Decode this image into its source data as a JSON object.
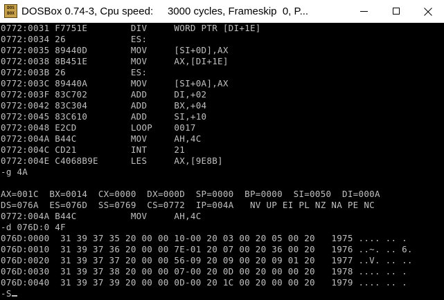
{
  "window": {
    "title": "DOSBox 0.74-3, Cpu speed:     3000 cycles, Frameskip  0, P...",
    "icon": "dosbox-icon",
    "icon_text_top": "DOS",
    "icon_text_bottom": "BOX"
  },
  "console": {
    "lines": [
      "0772:0031 F7751E        DIV     WORD PTR [DI+1E]",
      "0772:0034 26            ES:",
      "0772:0035 89440D        MOV     [SI+0D],AX",
      "0772:0038 8B451E        MOV     AX,[DI+1E]",
      "0772:003B 26            ES:",
      "0772:003C 89440A        MOV     [SI+0A],AX",
      "0772:003F 83C702        ADD     DI,+02",
      "0772:0042 83C304        ADD     BX,+04",
      "0772:0045 83C610        ADD     SI,+10",
      "0772:0048 E2CD          LOOP    0017",
      "0772:004A B44C          MOV     AH,4C",
      "0772:004C CD21          INT     21",
      "0772:004E C4068B9E      LES     AX,[9E8B]",
      "-g 4A",
      "",
      "AX=001C  BX=0014  CX=0000  DX=000D  SP=0000  BP=0000  SI=0050  DI=000A",
      "DS=076A  ES=076D  SS=0769  CS=0772  IP=004A   NV UP EI PL NZ NA PE NC",
      "0772:004A B44C          MOV     AH,4C",
      "-d 076D:0 4F",
      "076D:0000  31 39 37 35 20 00 00 10-00 20 03 00 20 05 00 20   1975 .... .. .",
      "076D:0010  31 39 37 36 20 00 00 7E-01 20 07 00 20 36 00 20   1976 ..~. .. 6.",
      "076D:0020  31 39 37 37 20 00 00 56-09 20 09 00 20 09 01 20   1977 ..V. .. ..",
      "076D:0030  31 39 37 38 20 00 00 07-00 20 0D 00 20 00 00 20   1978 .... .. .",
      "076D:0040  31 39 37 39 20 00 00 0D-00 20 1C 00 20 00 00 20   1979 .... .. .",
      "-S"
    ]
  },
  "colors": {
    "console_bg": "#000000",
    "console_fg": "#c0c0c0",
    "titlebar_bg": "#ffffff"
  }
}
